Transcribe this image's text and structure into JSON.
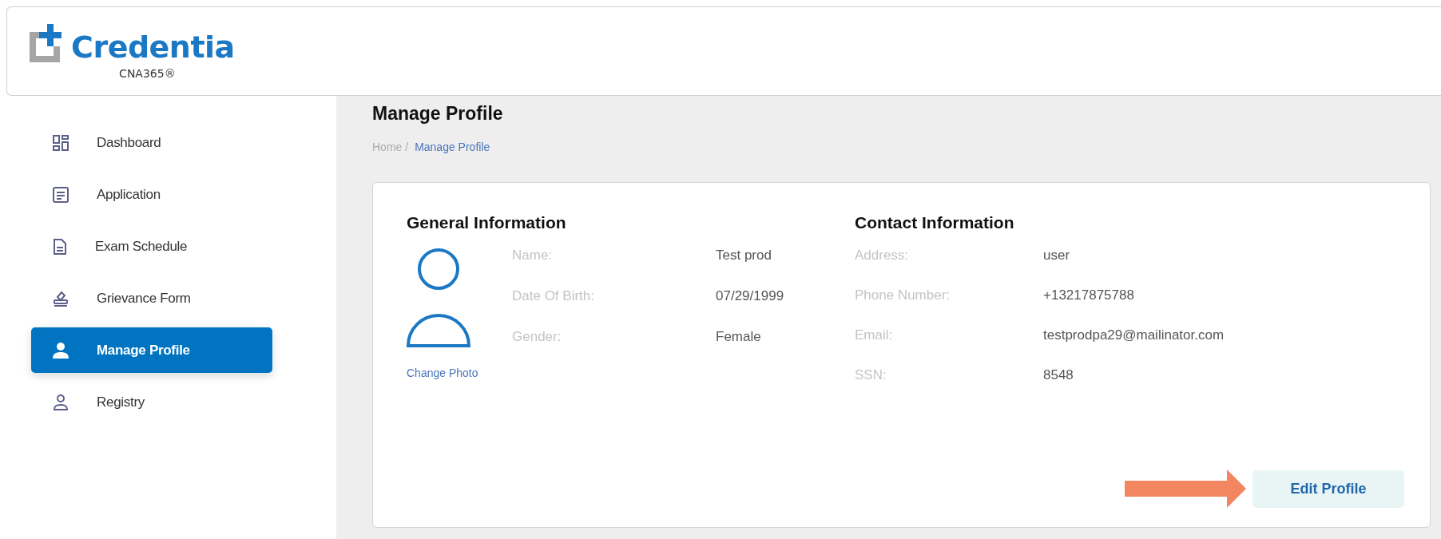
{
  "logo": {
    "name": "Credentia",
    "product": "CNA365®"
  },
  "sidebar": {
    "items": [
      {
        "label": "Dashboard",
        "selected": false
      },
      {
        "label": "Application",
        "selected": false
      },
      {
        "label": "Exam Schedule",
        "selected": false
      },
      {
        "label": "Grievance Form",
        "selected": false
      },
      {
        "label": "Manage Profile",
        "selected": true
      },
      {
        "label": "Registry",
        "selected": false
      }
    ]
  },
  "page": {
    "title": "Manage Profile",
    "breadcrumb": [
      {
        "label": "Home /",
        "selected": false
      },
      {
        "label": "Manage Profile",
        "selected": true
      }
    ]
  },
  "general_information": {
    "title": "General Information",
    "change_photo": "Change Photo",
    "fields": [
      {
        "label": "Name:",
        "value": "Test prod"
      },
      {
        "label": "Date Of Birth:",
        "value": "07/29/1999"
      },
      {
        "label": "Gender:",
        "value": "Female"
      }
    ]
  },
  "contact_information": {
    "title": "Contact Information",
    "fields": [
      {
        "label": "Address:",
        "value": "user"
      },
      {
        "label": "Phone Number:",
        "value": "+13217875788"
      },
      {
        "label": "Email:",
        "value": "testprodpa29@mailinator.com"
      },
      {
        "label": "SSN:",
        "value": "8548"
      }
    ]
  },
  "edit_button": {
    "label": "Edit Profile"
  }
}
